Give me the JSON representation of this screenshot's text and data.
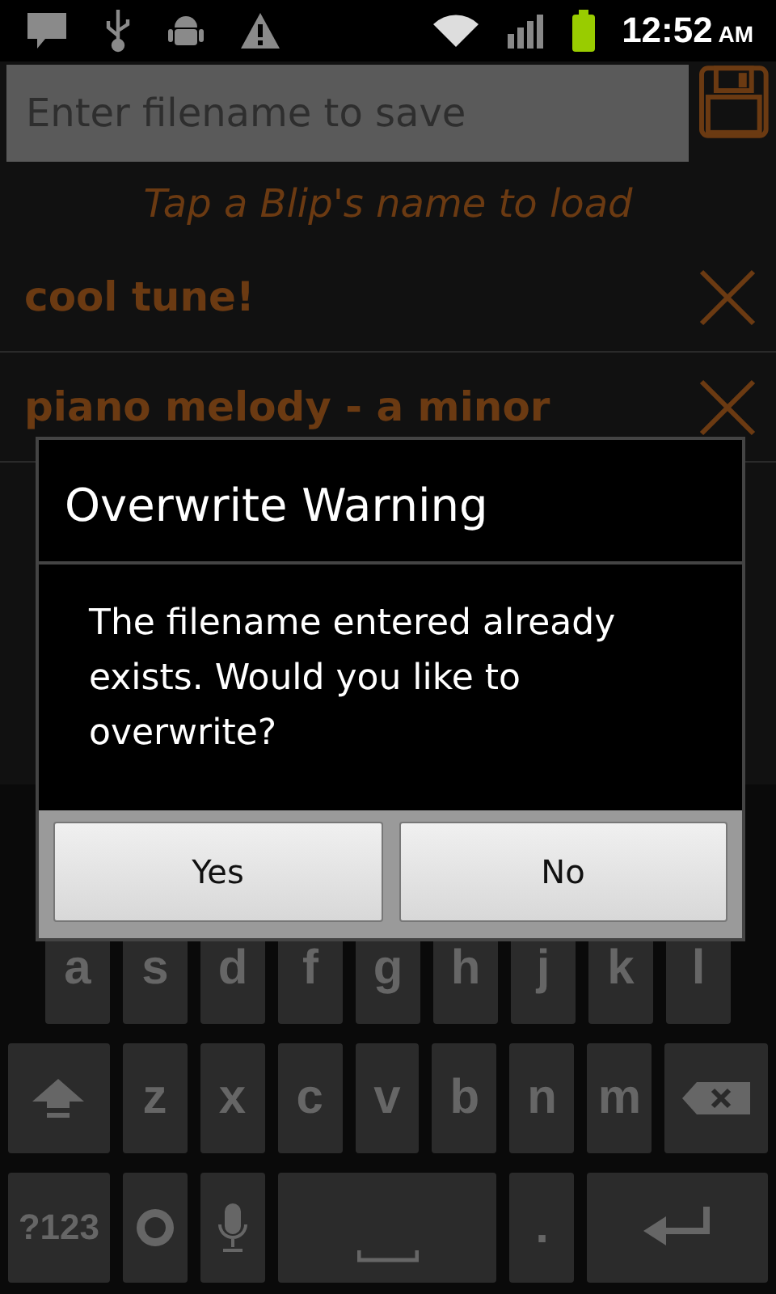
{
  "status_bar": {
    "time": "12:52",
    "ampm": "AM"
  },
  "filename_field": {
    "placeholder": "Enter filename to save"
  },
  "hint": "Tap a Blip's name to load",
  "blips": [
    {
      "name": "cool tune!"
    },
    {
      "name": "piano melody - a minor"
    }
  ],
  "dialog": {
    "title": "Overwrite Warning",
    "message": "The filename entered already exists. Would you like to overwrite?",
    "buttons": [
      "Yes",
      "No"
    ]
  },
  "keyboard": {
    "rows": [
      {
        "keys": [
          {
            "kind": "key",
            "label": "a"
          },
          {
            "kind": "key",
            "label": "s"
          },
          {
            "kind": "key",
            "label": "d"
          },
          {
            "kind": "key",
            "label": "f"
          },
          {
            "kind": "key",
            "label": "g"
          },
          {
            "kind": "key",
            "label": "h"
          },
          {
            "kind": "key",
            "label": "j"
          },
          {
            "kind": "key",
            "label": "k"
          },
          {
            "kind": "key",
            "label": "l"
          }
        ]
      },
      {
        "keys": [
          {
            "kind": "shift"
          },
          {
            "kind": "key",
            "label": "z"
          },
          {
            "kind": "key",
            "label": "x"
          },
          {
            "kind": "key",
            "label": "c"
          },
          {
            "kind": "key",
            "label": "v"
          },
          {
            "kind": "key",
            "label": "b"
          },
          {
            "kind": "key",
            "label": "n"
          },
          {
            "kind": "key",
            "label": "m"
          },
          {
            "kind": "delete"
          }
        ]
      },
      {
        "keys": [
          {
            "kind": "mode",
            "label": "?123"
          },
          {
            "kind": "settings"
          },
          {
            "kind": "mic"
          },
          {
            "kind": "space"
          },
          {
            "kind": "key",
            "label": "."
          },
          {
            "kind": "enter"
          }
        ]
      }
    ]
  }
}
